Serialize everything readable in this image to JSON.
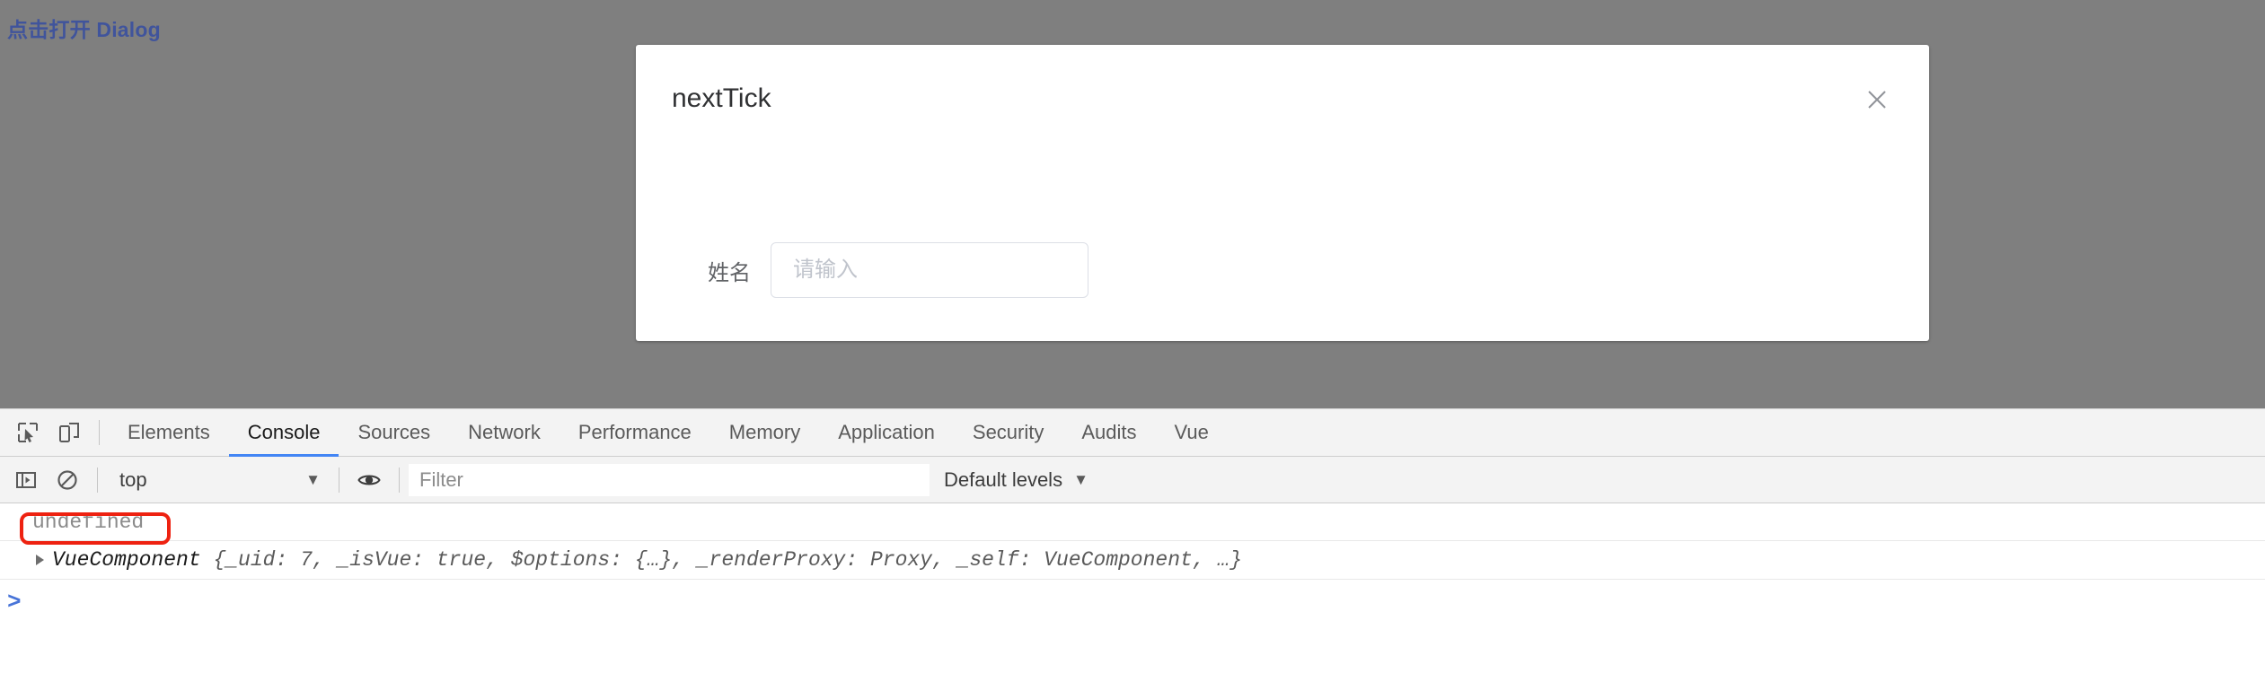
{
  "page": {
    "trigger_link_label": "点击打开 Dialog",
    "trigger_link_color": "#40549c",
    "overlay_color": "rgba(0,0,0,0.5)"
  },
  "dialog": {
    "title": "nextTick",
    "close_icon": "close-icon",
    "form": {
      "label": "姓名",
      "input_value": "",
      "input_placeholder": "请输入"
    }
  },
  "devtools": {
    "toolbar_icons": [
      {
        "name": "inspect-element-icon"
      },
      {
        "name": "device-toolbar-icon"
      }
    ],
    "tabs": [
      {
        "label": "Elements",
        "active": false
      },
      {
        "label": "Console",
        "active": true
      },
      {
        "label": "Sources",
        "active": false
      },
      {
        "label": "Network",
        "active": false
      },
      {
        "label": "Performance",
        "active": false
      },
      {
        "label": "Memory",
        "active": false
      },
      {
        "label": "Application",
        "active": false
      },
      {
        "label": "Security",
        "active": false
      },
      {
        "label": "Audits",
        "active": false
      },
      {
        "label": "Vue",
        "active": false
      }
    ],
    "active_tab_underline_color": "#4285f4",
    "console_toolbar": {
      "sidebar_toggle_icon": "console-sidebar-icon",
      "clear_console_icon": "clear-console-icon",
      "context_selected": "top",
      "context_caret": "▼",
      "live_expression_icon": "eye-icon",
      "filter_value": "",
      "filter_placeholder": "Filter",
      "levels_label": "Default levels",
      "levels_caret": "▼"
    },
    "console_rows": [
      {
        "type": "result",
        "text": "undefined",
        "annotated": true,
        "annotation_color": "#ee2211"
      },
      {
        "type": "object",
        "disclosure": "collapsed",
        "constructor": "VueComponent",
        "preview": " {_uid: 7, _isVue: true, $options: {…}, _renderProxy: Proxy, _self: VueComponent, …}"
      }
    ],
    "prompt_caret": ">"
  }
}
